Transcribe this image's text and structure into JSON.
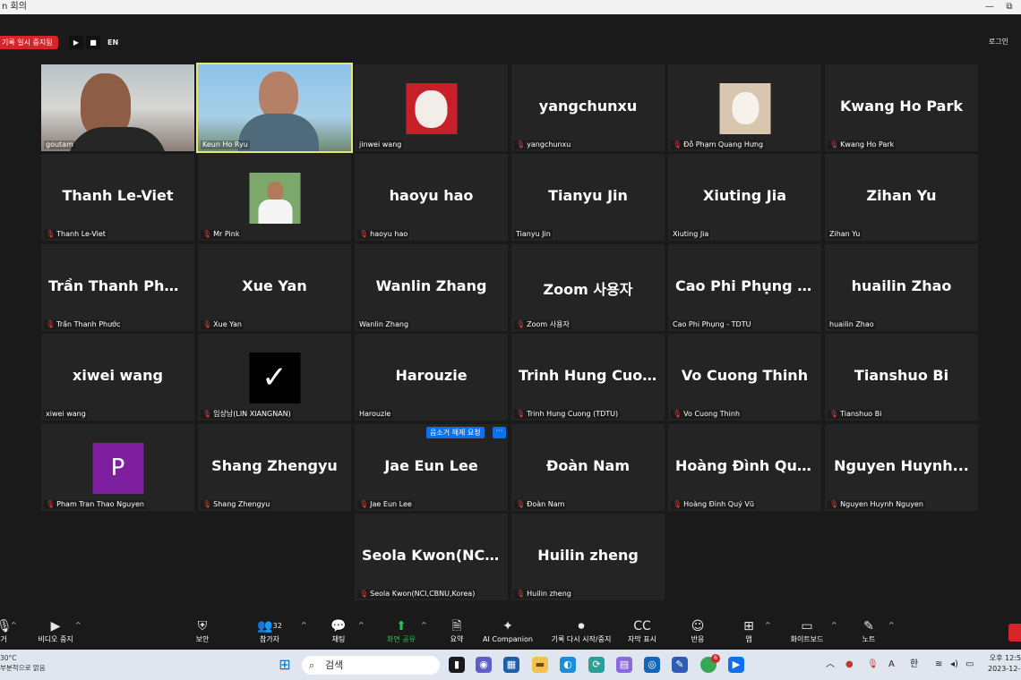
{
  "window": {
    "title": "n 회의",
    "minimize": "—",
    "restore": "⧉"
  },
  "recording": {
    "label": "기록 일시 중지됨",
    "play": "▶",
    "stop": "■",
    "lang": "EN"
  },
  "login": "로그인",
  "unmute_request": "음소거 해제 요청",
  "more": "···",
  "tiles": [
    {
      "label": "goutam",
      "display": "",
      "muted": false,
      "kind": "video1"
    },
    {
      "label": "Keun Ho Ryu",
      "display": "",
      "muted": false,
      "kind": "video2",
      "active": true
    },
    {
      "label": "jinwei wang",
      "display": "",
      "muted": false,
      "kind": "cartoon"
    },
    {
      "label": "yangchunxu",
      "display": "yangchunxu",
      "muted": true
    },
    {
      "label": "Đỗ Phạm Quang Hưng",
      "display": "",
      "muted": true,
      "kind": "cat"
    },
    {
      "label": "Kwang Ho Park",
      "display": "Kwang Ho Park",
      "muted": true
    },
    {
      "label": "Thanh Le-Viet",
      "display": "Thanh Le-Viet",
      "muted": true
    },
    {
      "label": "Mr Pink",
      "display": "",
      "muted": true,
      "kind": "person"
    },
    {
      "label": "haoyu hao",
      "display": "haoyu hao",
      "muted": true
    },
    {
      "label": "Tianyu Jin",
      "display": "Tianyu Jin",
      "muted": false
    },
    {
      "label": "Xiuting Jia",
      "display": "Xiuting Jia",
      "muted": false
    },
    {
      "label": "Zihan Yu",
      "display": "Zihan Yu",
      "muted": false
    },
    {
      "label": "Trần Thanh Phước",
      "display": "Trần Thanh Phước",
      "muted": true
    },
    {
      "label": "Xue Yan",
      "display": "Xue Yan",
      "muted": true
    },
    {
      "label": "Wanlin Zhang",
      "display": "Wanlin Zhang",
      "muted": false
    },
    {
      "label": "Zoom 사용자",
      "display": "Zoom 사용자",
      "muted": true
    },
    {
      "label": "Cao Phi Phụng - TDTU",
      "display": "Cao Phi Phụng -...",
      "muted": false
    },
    {
      "label": "huailin Zhao",
      "display": "huailin Zhao",
      "muted": false
    },
    {
      "label": "xiwei wang",
      "display": "xiwei wang",
      "muted": false
    },
    {
      "label": "임상남(LIN XIANGNAN)",
      "display": "",
      "muted": true,
      "kind": "nike"
    },
    {
      "label": "Harouzie",
      "display": "Harouzie",
      "muted": false
    },
    {
      "label": "Trinh Hung Cuong (TDTU)",
      "display": "Trinh Hung Cuo...",
      "muted": true
    },
    {
      "label": "Vo Cuong Thinh",
      "display": "Vo Cuong Thinh",
      "muted": true
    },
    {
      "label": "Tianshuo Bi",
      "display": "Tianshuo Bi",
      "muted": true
    },
    {
      "label": "Pham Tran Thao Nguyen",
      "display": "",
      "muted": true,
      "kind": "p",
      "initial": "P"
    },
    {
      "label": "Shang Zhengyu",
      "display": "Shang Zhengyu",
      "muted": true
    },
    {
      "label": "Jae Eun Lee",
      "display": "Jae Eun Lee",
      "muted": true,
      "hover": true
    },
    {
      "label": "Đoàn Nam",
      "display": "Đoàn Nam",
      "muted": true
    },
    {
      "label": "Hoàng Đình Quý Vũ",
      "display": "Hoàng Đình Quý...",
      "muted": true
    },
    {
      "label": "Nguyen Huynh Nguyen",
      "display": "Nguyen Huynh...",
      "muted": true
    },
    {
      "label": "Seola Kwon(NCI,CBNU,Korea)",
      "display": "Seola Kwon(NCI,...",
      "muted": true
    },
    {
      "label": "Huilin zheng",
      "display": "Huilin zheng",
      "muted": true
    }
  ],
  "toolbar": [
    {
      "label": "거",
      "icon": "mic-icon"
    },
    {
      "label": "비디오 중지",
      "icon": "video-icon"
    },
    {
      "label": "보안",
      "icon": "shield-icon"
    },
    {
      "label": "참가자",
      "icon": "participants-icon",
      "count": "32"
    },
    {
      "label": "채팅",
      "icon": "chat-icon"
    },
    {
      "label": "화면 공유",
      "icon": "share-icon"
    },
    {
      "label": "요약",
      "icon": "summary-icon"
    },
    {
      "label": "AI Companion",
      "icon": "sparkle-icon"
    },
    {
      "label": "기록 다시 시작/중지",
      "icon": "record-icon"
    },
    {
      "label": "자막 표시",
      "icon": "cc-icon"
    },
    {
      "label": "반응",
      "icon": "reaction-icon"
    },
    {
      "label": "앱",
      "icon": "apps-icon"
    },
    {
      "label": "화이트보드",
      "icon": "whiteboard-icon"
    },
    {
      "label": "노트",
      "icon": "notes-icon"
    }
  ],
  "taskbar": {
    "weather_temp": "30°C",
    "weather_text": "부분적으로 맑음",
    "search_placeholder": "검색",
    "lang": "A",
    "ime": "한",
    "time": "오후 12:5",
    "date": "2023-12-2",
    "chrome_badge": "6"
  }
}
